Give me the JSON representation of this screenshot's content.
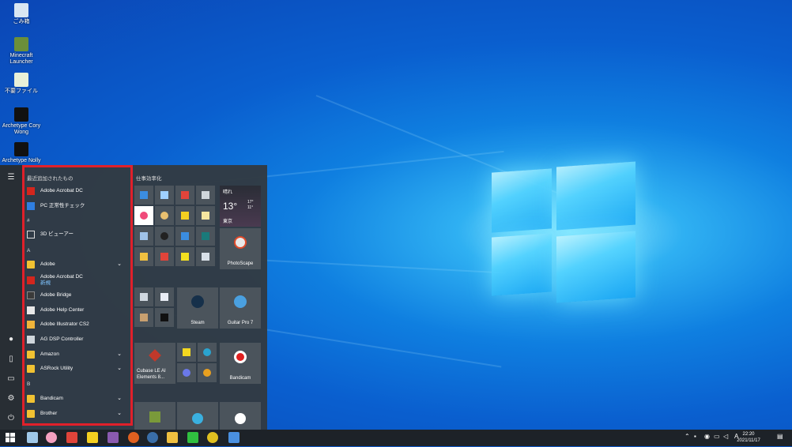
{
  "desktop": {
    "icons": [
      {
        "label": "ごみ箱"
      },
      {
        "label": "Minecraft Launcher"
      },
      {
        "label": "不要ファイル"
      },
      {
        "label": "Archetype Cory Wong"
      },
      {
        "label": "Archetype Nolly"
      }
    ]
  },
  "start_menu": {
    "recent_header": "最近追加されたもの",
    "recent": [
      {
        "label": "Adobe Acrobat DC"
      },
      {
        "label": "PC 正常性チェック"
      }
    ],
    "hash_header": "#",
    "hash_items": [
      {
        "label": "3D ビューアー"
      }
    ],
    "a_header": "A",
    "a_items": [
      {
        "label": "Adobe"
      },
      {
        "label": "Adobe Acrobat DC",
        "sub": "新規"
      },
      {
        "label": "Adobe Bridge"
      },
      {
        "label": "Adobe Help Center"
      },
      {
        "label": "Adobe Illustrator CS2"
      },
      {
        "label": "AG DSP Controller"
      },
      {
        "label": "Amazon"
      },
      {
        "label": "ASRock Utility"
      }
    ],
    "b_header": "B",
    "b_items": [
      {
        "label": "Bandicam"
      },
      {
        "label": "Brother"
      }
    ],
    "tiles": {
      "group_title": "仕事効率化",
      "weather": {
        "title": "晴れ",
        "temp": "13°",
        "high": "17°",
        "low": "11°",
        "city": "東京"
      },
      "photoscape": "PhotoScape",
      "steam": "Steam",
      "guitar_pro": "Guitar Pro 7",
      "cubase": "Cubase LE AI Elements 8...",
      "bandicam": "Bandicam"
    }
  },
  "taskbar": {
    "time": "22:20",
    "date": "2021/11/17",
    "ime": "A"
  }
}
